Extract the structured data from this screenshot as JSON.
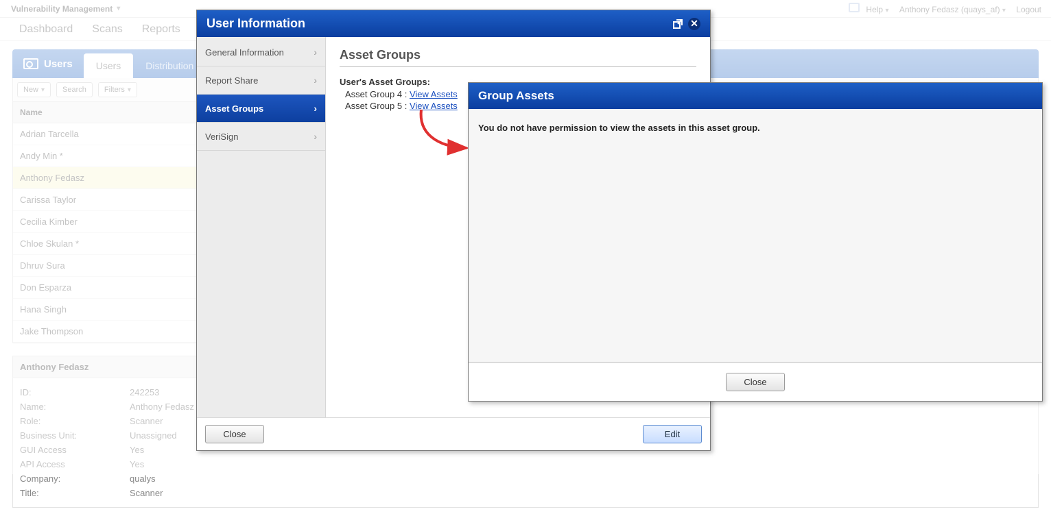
{
  "topbar": {
    "module": "Vulnerability Management",
    "help": "Help",
    "user": "Anthony Fedasz (quays_af)",
    "logout": "Logout"
  },
  "nav": {
    "items": [
      "Dashboard",
      "Scans",
      "Reports"
    ]
  },
  "usersPanel": {
    "title": "Users",
    "tabs": [
      "Users",
      "Distribution"
    ],
    "toolbar": {
      "newBtn": "New",
      "search": "Search",
      "filters": "Filters"
    },
    "colName": "Name",
    "rows": [
      "Adrian Tarcella",
      "Andy Min *",
      "Anthony Fedasz",
      "Carissa Taylor",
      "Cecilia Kimber",
      "Chloe Skulan *",
      "Dhruv Sura",
      "Don Esparza",
      "Hana Singh",
      "Jake Thompson"
    ],
    "selectedIndex": 2
  },
  "detail": {
    "header": "Anthony Fedasz",
    "rows": [
      {
        "k": "ID:",
        "v": "242253"
      },
      {
        "k": "Name:",
        "v": "Anthony Fedasz"
      },
      {
        "k": "Role:",
        "v": "Scanner"
      },
      {
        "k": "Business Unit:",
        "v": "Unassigned"
      },
      {
        "k": "GUI Access",
        "v": "Yes"
      },
      {
        "k": "API Access",
        "v": "Yes"
      },
      {
        "k": "Company:",
        "v": "qualys"
      },
      {
        "k": "Title:",
        "v": "Scanner"
      }
    ]
  },
  "dlg1": {
    "title": "User Information",
    "side": [
      "General Information",
      "Report Share",
      "Asset Groups",
      "VeriSign"
    ],
    "activeIndex": 2,
    "heading": "Asset Groups",
    "groupsLabel": "User's Asset Groups:",
    "groups": [
      {
        "name": "Asset Group 4",
        "link": "View Assets"
      },
      {
        "name": "Asset Group 5",
        "link": "View Assets"
      }
    ],
    "closeBtn": "Close",
    "editBtn": "Edit"
  },
  "dlg2": {
    "title": "Group Assets",
    "message": "You do not have permission to view the assets in this asset group.",
    "closeBtn": "Close"
  }
}
